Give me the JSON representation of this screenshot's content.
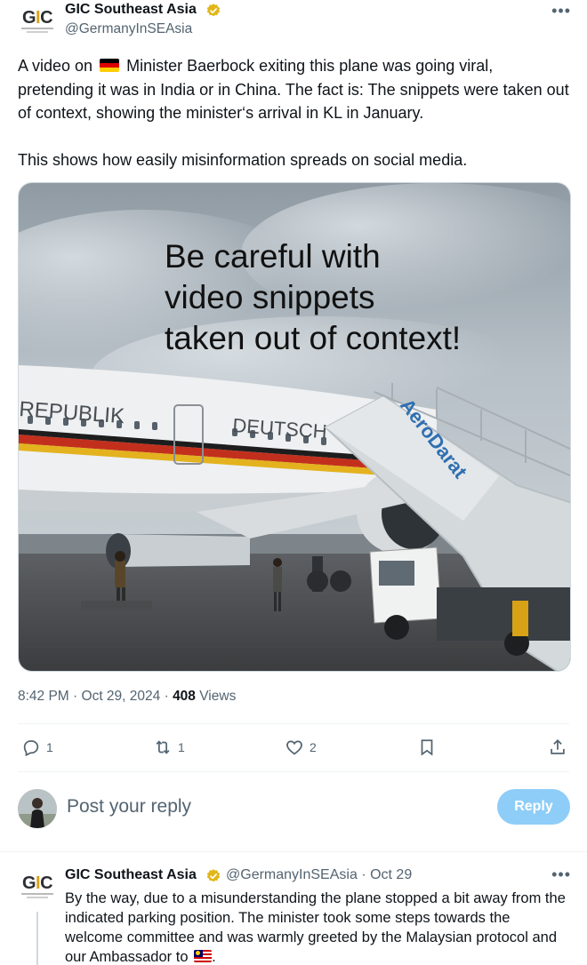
{
  "tweet": {
    "author_name": "GIC Southeast Asia",
    "author_handle": "@GermanyInSEAsia",
    "avatar_logo": "GIC",
    "more_icon": "more-icon",
    "text_part1": "A video on",
    "text_part2": "Minister Baerbock exiting this plane was going viral, pretending it was in India or in China.  The fact is: The snippets were taken out of context, showing the minister‘s arrival in KL in January.",
    "text_para2": "This shows how easily misinformation spreads on social media.",
    "media": {
      "caption_line1": "Be careful with",
      "caption_line2": "video snippets",
      "caption_line3": "taken out of context!",
      "plane_text1": "REPUBLIK",
      "plane_text2": "DEUTSCH",
      "stairs_text": "AeroDarat"
    },
    "time": "8:42 PM",
    "date": "Oct 29, 2024",
    "views_count": "408",
    "views_label": "Views",
    "actions": {
      "reply_count": "1",
      "retweet_count": "1",
      "like_count": "2"
    }
  },
  "reply_box": {
    "placeholder": "Post your reply",
    "button_label": "Reply"
  },
  "reply_tweet": {
    "author_name": "GIC Southeast Asia",
    "author_handle": "@GermanyInSEAsia",
    "separator": "·",
    "date": "Oct 29",
    "text": "By the way, due to a misunderstanding the plane stopped a bit away from the indicated parking position. The minister took some steps towards the welcome committee and was warmly greeted by the Malaysian protocol and our Ambassador to",
    "text_end": "."
  },
  "colors": {
    "accent": "#1d9bf0",
    "reply_button_disabled": "#8ecdf8",
    "secondary_text": "#536471",
    "verified_gold": "#e2b719"
  }
}
